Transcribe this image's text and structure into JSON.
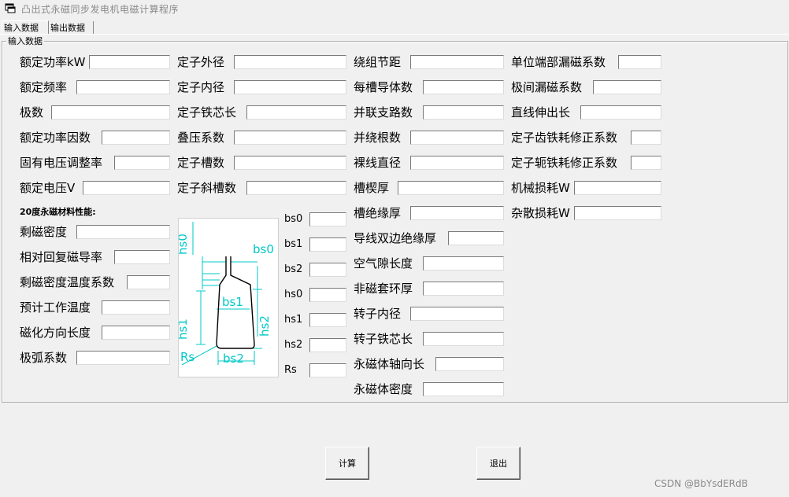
{
  "window": {
    "title": "凸出式永磁同步发电机电磁计算程序"
  },
  "tabs": [
    {
      "label": "输入数据"
    },
    {
      "label": "输出数据"
    }
  ],
  "group": {
    "label": "输入数据"
  },
  "fields": {
    "c1": [
      "额定功率kW",
      "额定频率",
      "极数",
      "额定功率因数",
      "固有电压调整率",
      "额定电压V"
    ],
    "c2": [
      "定子外径",
      "定子内径",
      "定子铁芯长",
      "叠压系数",
      "定子槽数",
      "定子斜槽数"
    ],
    "c3": [
      "绕组节距",
      "每槽导体数",
      "并联支路数",
      "并绕根数",
      "裸线直径",
      "槽楔厚",
      "槽绝缘厚",
      "导线双边绝缘厚",
      "空气隙长度",
      "非磁套环厚",
      "转子内径",
      "转子铁芯长",
      "永磁体轴向长",
      "永磁体密度"
    ],
    "c4": [
      "单位端部漏磁系数",
      "极间漏磁系数",
      "直线伸出长",
      "定子齿铁耗修正系数",
      "定子轭铁耗修正系数",
      "机械损耗W",
      "杂散损耗W"
    ]
  },
  "magnet": {
    "heading": "20度永磁材料性能:",
    "labels": [
      "剩磁密度",
      "相对回复磁导率",
      "剩磁密度温度系数",
      "预计工作温度",
      "磁化方向长度",
      "极弧系数"
    ]
  },
  "slot": {
    "labels": [
      "bs0",
      "bs1",
      "bs2",
      "hs0",
      "hs1",
      "hs2",
      "Rs"
    ],
    "diagram_labels": {
      "hs0": "hs0",
      "bs0": "bs0",
      "bs1": "bs1",
      "hs1": "hs1",
      "hs2": "hs2",
      "Rs": "Rs",
      "bs2": "bs2"
    }
  },
  "buttons": {
    "calculate": "计算",
    "exit": "退出"
  },
  "watermark": "CSDN @BbYsdERdB",
  "colors": {
    "diagram_lines": "#00c8c8",
    "background": "#f0f0f0"
  }
}
